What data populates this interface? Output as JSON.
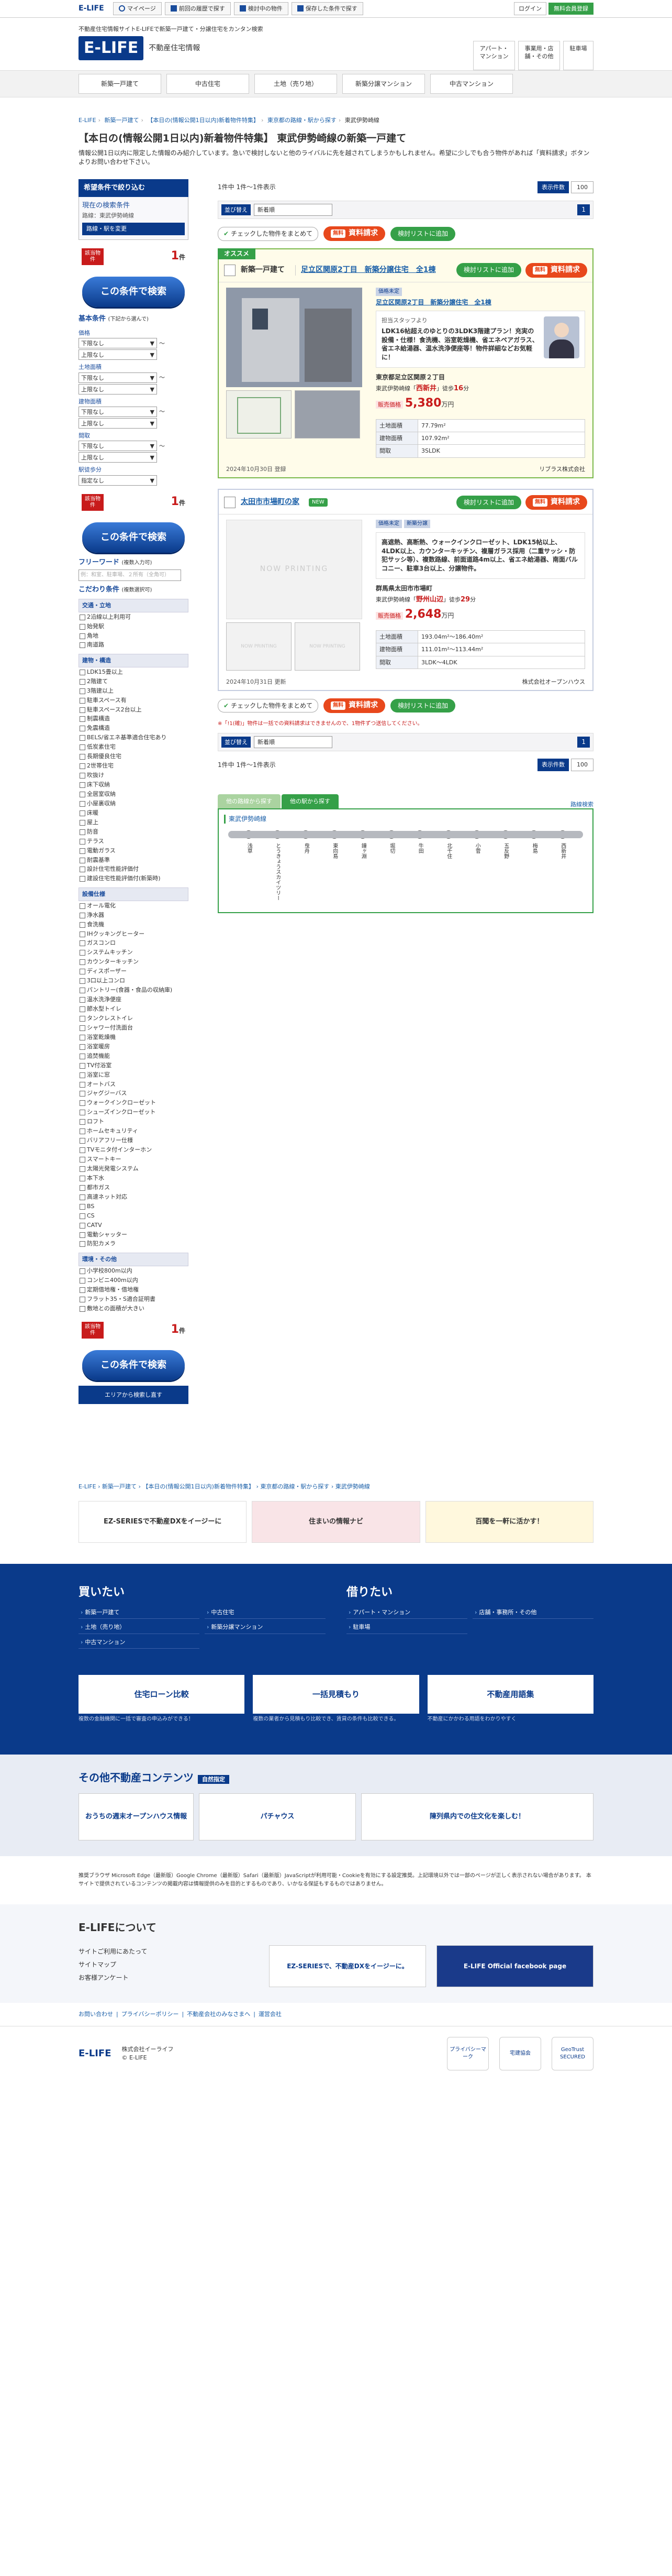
{
  "topbar": {
    "logo": "E-LIFE",
    "mypage": "マイページ",
    "recent": "前回の履歴で探す",
    "history": "検討中の物件",
    "saved": "保存した条件で探す",
    "login": "ログイン",
    "register": "無料会員登録"
  },
  "header": {
    "tagline": "不動産住宅情報サイトE-LIFEで新築一戸建て・分譲住宅をカンタン検索",
    "logo": "E-LIFE",
    "subtitle": "不動産住宅情報",
    "b1": "アパート・マンション",
    "b2": "事業用・店舗・その他",
    "b3": "駐車場"
  },
  "gnav": [
    "新築一戸建て",
    "中古住宅",
    "土地（売り地）",
    "新築分譲マンション",
    "中古マンション"
  ],
  "crumb": [
    "E-LIFE",
    "新築一戸建て",
    "【本日の(情報公開1日以内)新着物件特集】",
    "東京都の路線・駅から探す",
    "東武伊勢崎線"
  ],
  "title": "【本日の(情報公開1日以内)新着物件特集】 東武伊勢崎線の新築一戸建て",
  "lead": "情報公開1日以内に限定した情報のみ紹介しています。急いで検討しないと他のライバルに先を越されてしまうかもしれません。希望に少しでも合う物件があれば「資料請求」ボタンよりお問い合わせ下さい。",
  "side": {
    "head": "希望条件で絞り込む",
    "cond_title": "現在の検索条件",
    "cond_value": "路線：東武伊勢崎線",
    "change": "路線・駅を変更",
    "hit_label": "該当物件",
    "hit_count": "1",
    "hit_unit": "件",
    "search_btn": "この条件で検索",
    "basic": "基本条件",
    "basic_note": "(下記から選んで)",
    "price_label": "価格",
    "min": "下限なし",
    "max": "上限なし",
    "land_label": "土地面積",
    "bld_label": "建物面積",
    "layout_label": "間取",
    "layout_v1": "下限なし",
    "layout_v2": "上限なし",
    "walk_label": "駅徒歩分",
    "walk_v": "指定なし",
    "free_title": "フリーワード",
    "free_note": "(複数入力可)",
    "free_ph": "例：和室、駐車場、２所有（全角可）",
    "more_title": "こだわり条件",
    "more_note": "(複数選択可)",
    "groups": [
      {
        "title": "交通・立地",
        "items": [
          "2沿線以上利用可",
          "始発駅",
          "角地",
          "南道路"
        ]
      },
      {
        "title": "建物・構造",
        "items": [
          "LDK15畳以上",
          "2階建て",
          "3階建以上",
          "駐車スペース有",
          "駐車スペース2台以上",
          "制震構造",
          "免震構造",
          "BELS/省エネ基準適合住宅あり",
          "低炭素住宅",
          "長期優良住宅",
          "2世帯住宅",
          "吹抜け",
          "床下収納",
          "全居室収納",
          "小屋裏収納",
          "床暖",
          "屋上",
          "防音",
          "テラス",
          "電動ガラス",
          "耐震基準",
          "設計住宅性能評価付",
          "建設住宅性能評価付(新築時)"
        ]
      },
      {
        "title": "設備仕様",
        "items": [
          "オール電化",
          "浄水器",
          "食洗機",
          "IHクッキングヒーター",
          "ガスコンロ",
          "システムキッチン",
          "カウンターキッチン",
          "ディスポーザー",
          "3口以上コンロ",
          "パントリー(食器・食品の収納庫)",
          "温水洗浄便座",
          "節水型トイレ",
          "タンクレストイレ",
          "シャワー付洗面台",
          "浴室乾燥機",
          "浴室暖房",
          "追焚機能",
          "TV付浴室",
          "浴室に窓",
          "オートバス",
          "ジャグジーバス",
          "ウォークインクローゼット",
          "シューズインクローゼット",
          "ロフト",
          "ホームセキュリティ",
          "バリアフリー仕様",
          "TVモニタ付インターホン",
          "スマートキー",
          "太陽光発電システム",
          "本下水",
          "都市ガス",
          "高速ネット対応",
          "BS",
          "CS",
          "CATV",
          "電動シャッター",
          "防犯カメラ"
        ]
      },
      {
        "title": "環境・その他",
        "items": [
          "小学校800m以内",
          "コンビニ400m以内",
          "定期借地権・借地権",
          "フラット35・S適合証明書",
          "敷地との面積が大きい"
        ]
      }
    ],
    "area_btn": "エリアから検索し直す"
  },
  "main": {
    "count_text": "1件中 1件～1件表示",
    "per_page_label": "表示件数",
    "per_page": "100",
    "sort_label": "並び替え",
    "sort_value": "新着順",
    "page": "1",
    "select_all": "チェックした物件をまとめて",
    "free": "無料",
    "request": "資料請求",
    "compare": "検討リストに追加",
    "osusume": "オススメ",
    "cards": [
      {
        "type": "新築一戸建て",
        "title": "足立区関原2丁目　新築分譲住宅　全1棟",
        "tags": [
          "価格未定",
          "新築"
        ],
        "subtitle": "足立区関原2丁目　新築分譲住宅　全1棟",
        "pr_staff": "担当スタッフより",
        "pr_text": "LDK16帖超えのゆとりの3LDK3階建プラン！充実の設備・仕様！食洗機、浴室乾燥機、省エネペアガラス、省エネ給湯器、温水洗浄便座等！物件詳細などお気軽に！",
        "addr": "東京都足立区関原２丁目",
        "line": "東武伊勢崎線",
        "station": "西新井",
        "walk": "16",
        "price": "5,380",
        "land": "77.79m²",
        "bld": "107.92m²",
        "layout": "3SLDK",
        "date": "2024年10月30日 登録",
        "company": "リブラス株式会社"
      },
      {
        "type": "",
        "title": "太田市市場町の家",
        "tags": [
          "価格未定",
          "新築分譲"
        ],
        "new": "NEW",
        "pr_text": "高遮熱、高断熱、ウォークインクローゼット、LDK15帖以上、4LDK以上、カウンターキッチン、複層ガラス採用（二重サッシ・防犯サッシ等）、複数路線、前面道路4m以上、省エネ給湯器、南面バルコニー、駐車3台以上、分譲物件。",
        "addr": "群馬県太田市市場町",
        "line": "東武伊勢崎線",
        "station": "野州山辺",
        "walk": "29",
        "price": "2,648",
        "land": "193.04m²〜186.40m²",
        "bld": "111.01m²〜113.44m²",
        "layout": "3LDK〜4LDK",
        "date": "2024年10月31日 更新",
        "company": "株式会社オープンハウス"
      }
    ],
    "note": "※「!1(確)」物件は一括での資料請求はできませんので、1物件ずつ送信してください。",
    "route_tab1": "他の路線から探す",
    "route_tab2": "他の駅から探す",
    "route_link": "路線検索",
    "route_name": "東武伊勢崎線",
    "stations": [
      "浅草",
      "とうきょうスカイツリー",
      "曳舟",
      "東向島",
      "鐘ヶ淵",
      "堀切",
      "牛田",
      "北千住",
      "小菅",
      "五反野",
      "梅島",
      "西新井"
    ]
  },
  "bottom": {
    "banners": [
      "EZ-SERIESで不動産DXをイージーに",
      "住まいの情報ナビ",
      "百聞を一軒に活かす！"
    ]
  },
  "blue": {
    "buy": "買いたい",
    "buy_links": [
      "新築一戸建て",
      "中古住宅",
      "土地（売り地）",
      "新築分譲マンション",
      "中古マンション"
    ],
    "rent": "借りたい",
    "rent_links": [
      "アパート・マンション",
      "店舗・事務所・その他",
      "駐車場"
    ],
    "bb": [
      "住宅ローン比較",
      "一括見積もり",
      "不動産用語集"
    ],
    "bbcap": [
      "複数の金融機関に一括で審査の申込みができる！",
      "複数の業者から見積もり比較でき、賃貸の条件も比較できる。",
      "不動産にかかわる用語をわかりやすく"
    ]
  },
  "other": {
    "title": "その他不動産コンテンツ",
    "tag": "自然指定",
    "items": [
      "おうちの週末オープンハウス情報",
      "パチャウス",
      "陳列県内での住文化を楽しむ！"
    ]
  },
  "notice": "推奨ブラウザ Microsoft Edge（最新版）Google Chrome（最新版）Safari（最新版）JavaScriptが利用可能・Cookieを有効にする設定推奨。上記環境以外では一部のページが正しく表示されない場合があります。 本サイトで提供されているコンテンツの掲載内容は情報提供のみを目的とするものであり、いかなる保証もするものではありません。",
  "about": {
    "title": "E-LIFEについて",
    "links": [
      "サイトご利用にあたって",
      "サイトマップ",
      "お客様アンケート"
    ],
    "bn1": "EZ-SERIESで、不動産DXをイージーに。",
    "bn2": "E-LIFE Official facebook page"
  },
  "flinks": [
    "お問い合わせ",
    "プライバシーポリシー",
    "不動産会社のみなさまへ",
    "運営会社"
  ],
  "foot": {
    "logo": "E-LIFE",
    "company": "株式会社イーライフ",
    "copy": "© E-LIFE",
    "seals": [
      "プライバシーマーク",
      "宅建協会",
      "GeoTrust SECURED"
    ]
  }
}
